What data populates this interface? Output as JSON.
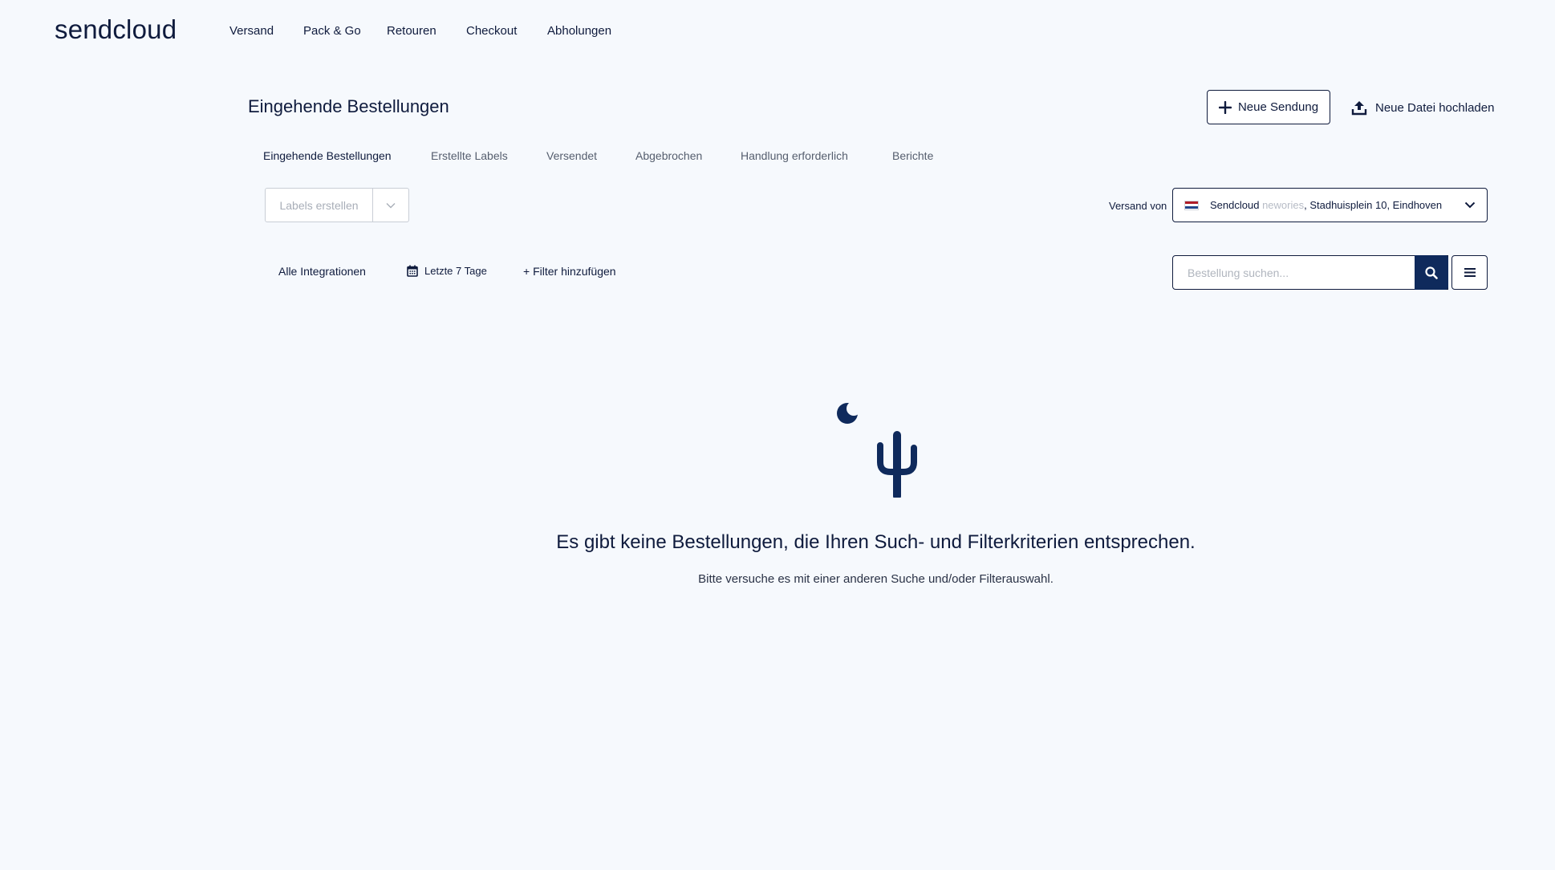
{
  "brand": {
    "logo": "sendcloud"
  },
  "nav": [
    {
      "label": "Versand"
    },
    {
      "label": "Pack & Go"
    },
    {
      "label": "Retouren"
    },
    {
      "label": "Checkout"
    },
    {
      "label": "Abholungen"
    }
  ],
  "page": {
    "title": "Eingehende Bestellungen",
    "new_shipment_label": "Neue Sendung",
    "upload_label": "Neue Datei hochladen"
  },
  "tabs": [
    {
      "label": "Eingehende Bestellungen",
      "active": true
    },
    {
      "label": "Erstellte Labels"
    },
    {
      "label": "Versendet"
    },
    {
      "label": "Abgebrochen"
    },
    {
      "label": "Handlung erforderlich"
    },
    {
      "label": "Berichte"
    }
  ],
  "actions": {
    "create_labels": "Labels erstellen"
  },
  "ship_from": {
    "label": "Versand von",
    "name": "Sendcloud",
    "redacted": "newories",
    "address": ", Stadhuisplein 10, Eindhoven",
    "flag_colors": [
      "#ae1c28",
      "#ffffff",
      "#21468b"
    ]
  },
  "filters": {
    "integrations": "Alle Integrationen",
    "date_range": "Letzte 7 Tage",
    "add_filter": "+ Filter hinzufügen"
  },
  "search": {
    "placeholder": "Bestellung suchen...",
    "value": ""
  },
  "empty_state": {
    "title": "Es gibt keine Bestellungen, die Ihren Such- und Filterkriterien entsprechen.",
    "subtitle": "Bitte versuche es mit einer anderen Suche und/oder Filterauswahl.",
    "illustration": "cactus-moon-icon"
  },
  "colors": {
    "primary": "#0f2a5c",
    "text": "#0f1b3d",
    "background": "#f6f9fd"
  }
}
